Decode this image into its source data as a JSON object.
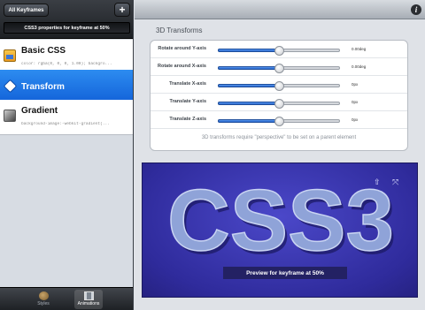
{
  "sidebar": {
    "all_keyframes_label": "All Keyframes",
    "add_label": "+",
    "caption": "CSS3 properties for keyframe at 50%",
    "items": [
      {
        "name": "Basic CSS",
        "detail": "color: rgba(0, 0, 0, 1.00); backgro...",
        "icon": "css-palette-icon",
        "selected": false
      },
      {
        "name": "Transform",
        "detail": "",
        "icon": "transform-icon",
        "selected": true
      },
      {
        "name": "Gradient",
        "detail": "background-image:-webkit-gradient(...",
        "icon": "gradient-icon",
        "selected": false
      }
    ],
    "tabs": [
      {
        "label": "Styles",
        "icon": "palette-icon",
        "active": false
      },
      {
        "label": "Animations",
        "icon": "film-icon",
        "active": true
      }
    ]
  },
  "header": {
    "info_label": "i"
  },
  "transforms": {
    "title": "3D Transforms",
    "rows": [
      {
        "label": "Rotate around Y-axis",
        "value": "0.00deg",
        "level": 0.5
      },
      {
        "label": "Rotate around X-axis",
        "value": "0.00deg",
        "level": 0.5
      },
      {
        "label": "Translate X-axis",
        "value": "0px",
        "level": 0.5
      },
      {
        "label": "Translate Y-axis",
        "value": "0px",
        "level": 0.5
      },
      {
        "label": "Translate Z-axis",
        "value": "0px",
        "level": 0.5
      }
    ],
    "note": "3D transforms require \"perspective\" to be set on a parent element"
  },
  "preview": {
    "text": "CSS3",
    "label": "Preview for keyframe at 50%",
    "arrow_label": "⇧",
    "expand_label": "⤧",
    "background_color": "#3c39b5",
    "text_color": "#8fa3d8"
  }
}
